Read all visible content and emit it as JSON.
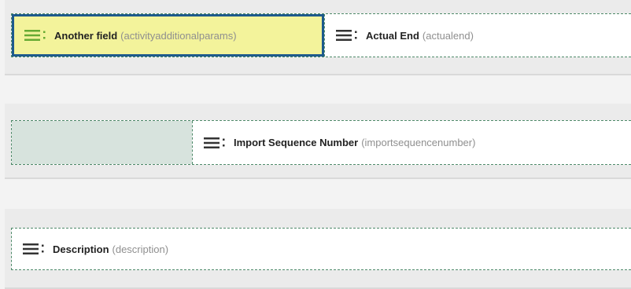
{
  "rows": [
    {
      "fields": [
        {
          "name": "Another field",
          "schema": "(activityadditionalparams)",
          "icon": "drag-handle-icon",
          "state": "selected"
        },
        {
          "name": "Actual End",
          "schema": "(actualend)",
          "icon": "drag-handle-icon",
          "state": "normal"
        }
      ]
    },
    {
      "fields": [
        {
          "name": "",
          "schema": "",
          "icon": "",
          "state": "empty"
        },
        {
          "name": "Import Sequence Number",
          "schema": "(importsequencenumber)",
          "icon": "drag-handle-icon",
          "state": "normal"
        }
      ]
    },
    {
      "fields": [
        {
          "name": "Description",
          "schema": "(description)",
          "icon": "drag-handle-icon",
          "state": "normal"
        }
      ]
    }
  ],
  "colors": {
    "selected_background": "#f3f39b",
    "selected_border": "#1e5a8c",
    "selected_icon": "#66aa33",
    "normal_icon": "#333333",
    "schema_text": "#8f8f8f",
    "cell_border": "#4f8a6a",
    "empty_cell": "#d7e3dd"
  }
}
